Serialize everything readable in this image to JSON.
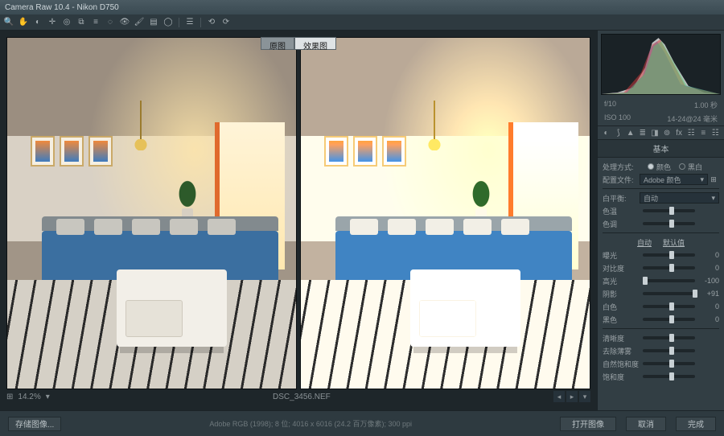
{
  "titlebar": {
    "title": "Camera Raw 10.4 - Nikon D750"
  },
  "toolbar_tools": [
    "zoom",
    "hand",
    "white-balance",
    "color-sampler",
    "target",
    "crop",
    "straighten",
    "spot",
    "redeye",
    "brush",
    "grad",
    "radial",
    "snapshot",
    "prefs",
    "rotate-l",
    "rotate-r"
  ],
  "tabs": {
    "before": "原图",
    "after": "效果图"
  },
  "footer": {
    "grid_icon": "⊞",
    "zoom": "14.2%",
    "filename": "DSC_3456.NEF",
    "info_line": "Adobe RGB (1998); 8 位; 4016 x 6016 (24.2 百万像素); 300 ppi"
  },
  "meta": {
    "aperture": "f/10",
    "shutter": "1.00 秒",
    "iso": "ISO 100",
    "lens": "14-24@24 毫米"
  },
  "panel": {
    "title": "基本",
    "treatment_label": "处理方式:",
    "treatment_color": "颜色",
    "treatment_bw": "黑白",
    "profile_label": "配置文件:",
    "profile_value": "Adobe 颜色",
    "wb_label": "白平衡:",
    "wb_value": "自动",
    "auto": "自动",
    "default": "默认值",
    "sliders": {
      "temp": {
        "label": "色温",
        "value": "",
        "pos": 50
      },
      "tint": {
        "label": "色调",
        "value": "",
        "pos": 50
      },
      "exposure": {
        "label": "曝光",
        "value": "0",
        "pos": 50
      },
      "contrast": {
        "label": "对比度",
        "value": "0",
        "pos": 50
      },
      "highlights": {
        "label": "高光",
        "value": "-100",
        "pos": 0
      },
      "shadows": {
        "label": "阴影",
        "value": "+91",
        "pos": 95
      },
      "whites": {
        "label": "白色",
        "value": "0",
        "pos": 50
      },
      "blacks": {
        "label": "黑色",
        "value": "0",
        "pos": 50
      },
      "clarity": {
        "label": "清晰度",
        "value": "",
        "pos": 50
      },
      "dehaze": {
        "label": "去除薄雾",
        "value": "",
        "pos": 50
      },
      "vibrance": {
        "label": "自然饱和度",
        "value": "",
        "pos": 50
      },
      "saturation": {
        "label": "饱和度",
        "value": "",
        "pos": 50
      }
    }
  },
  "bottom": {
    "save_image": "存储图像...",
    "open_image": "打开图像",
    "cancel": "取消",
    "done": "完成"
  }
}
